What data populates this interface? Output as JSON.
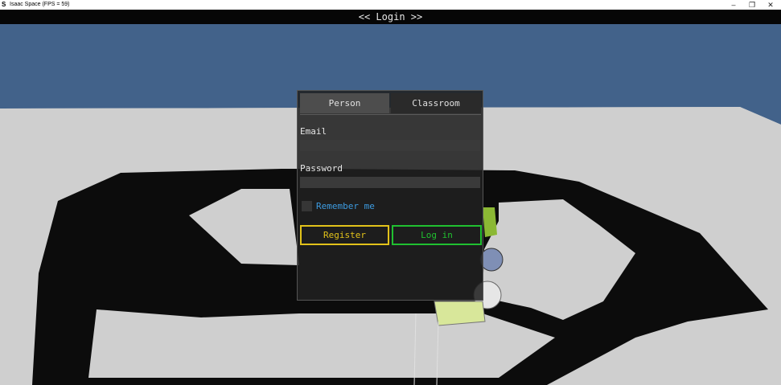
{
  "window": {
    "app_icon": "isaac-logo-icon",
    "title": "Isaac Space (FPS = 59)",
    "controls": {
      "minimize": "–",
      "maximize": "❐",
      "close": "✕"
    }
  },
  "header": {
    "title": "<< Login >>"
  },
  "login": {
    "tabs": [
      {
        "label": "Person",
        "active": true
      },
      {
        "label": "Classroom",
        "active": false
      }
    ],
    "email_label": "Email",
    "email_value": "",
    "password_label": "Password",
    "password_value": "",
    "remember_label": "Remember me",
    "remember_checked": false,
    "register_label": "Register",
    "login_label": "Log in"
  },
  "colors": {
    "sky": "#42628a",
    "floor": "#cfcfcf",
    "shadow": "#0c0c0c",
    "register_accent": "#e2c21a",
    "login_accent": "#20c030",
    "link": "#3d9be0"
  }
}
